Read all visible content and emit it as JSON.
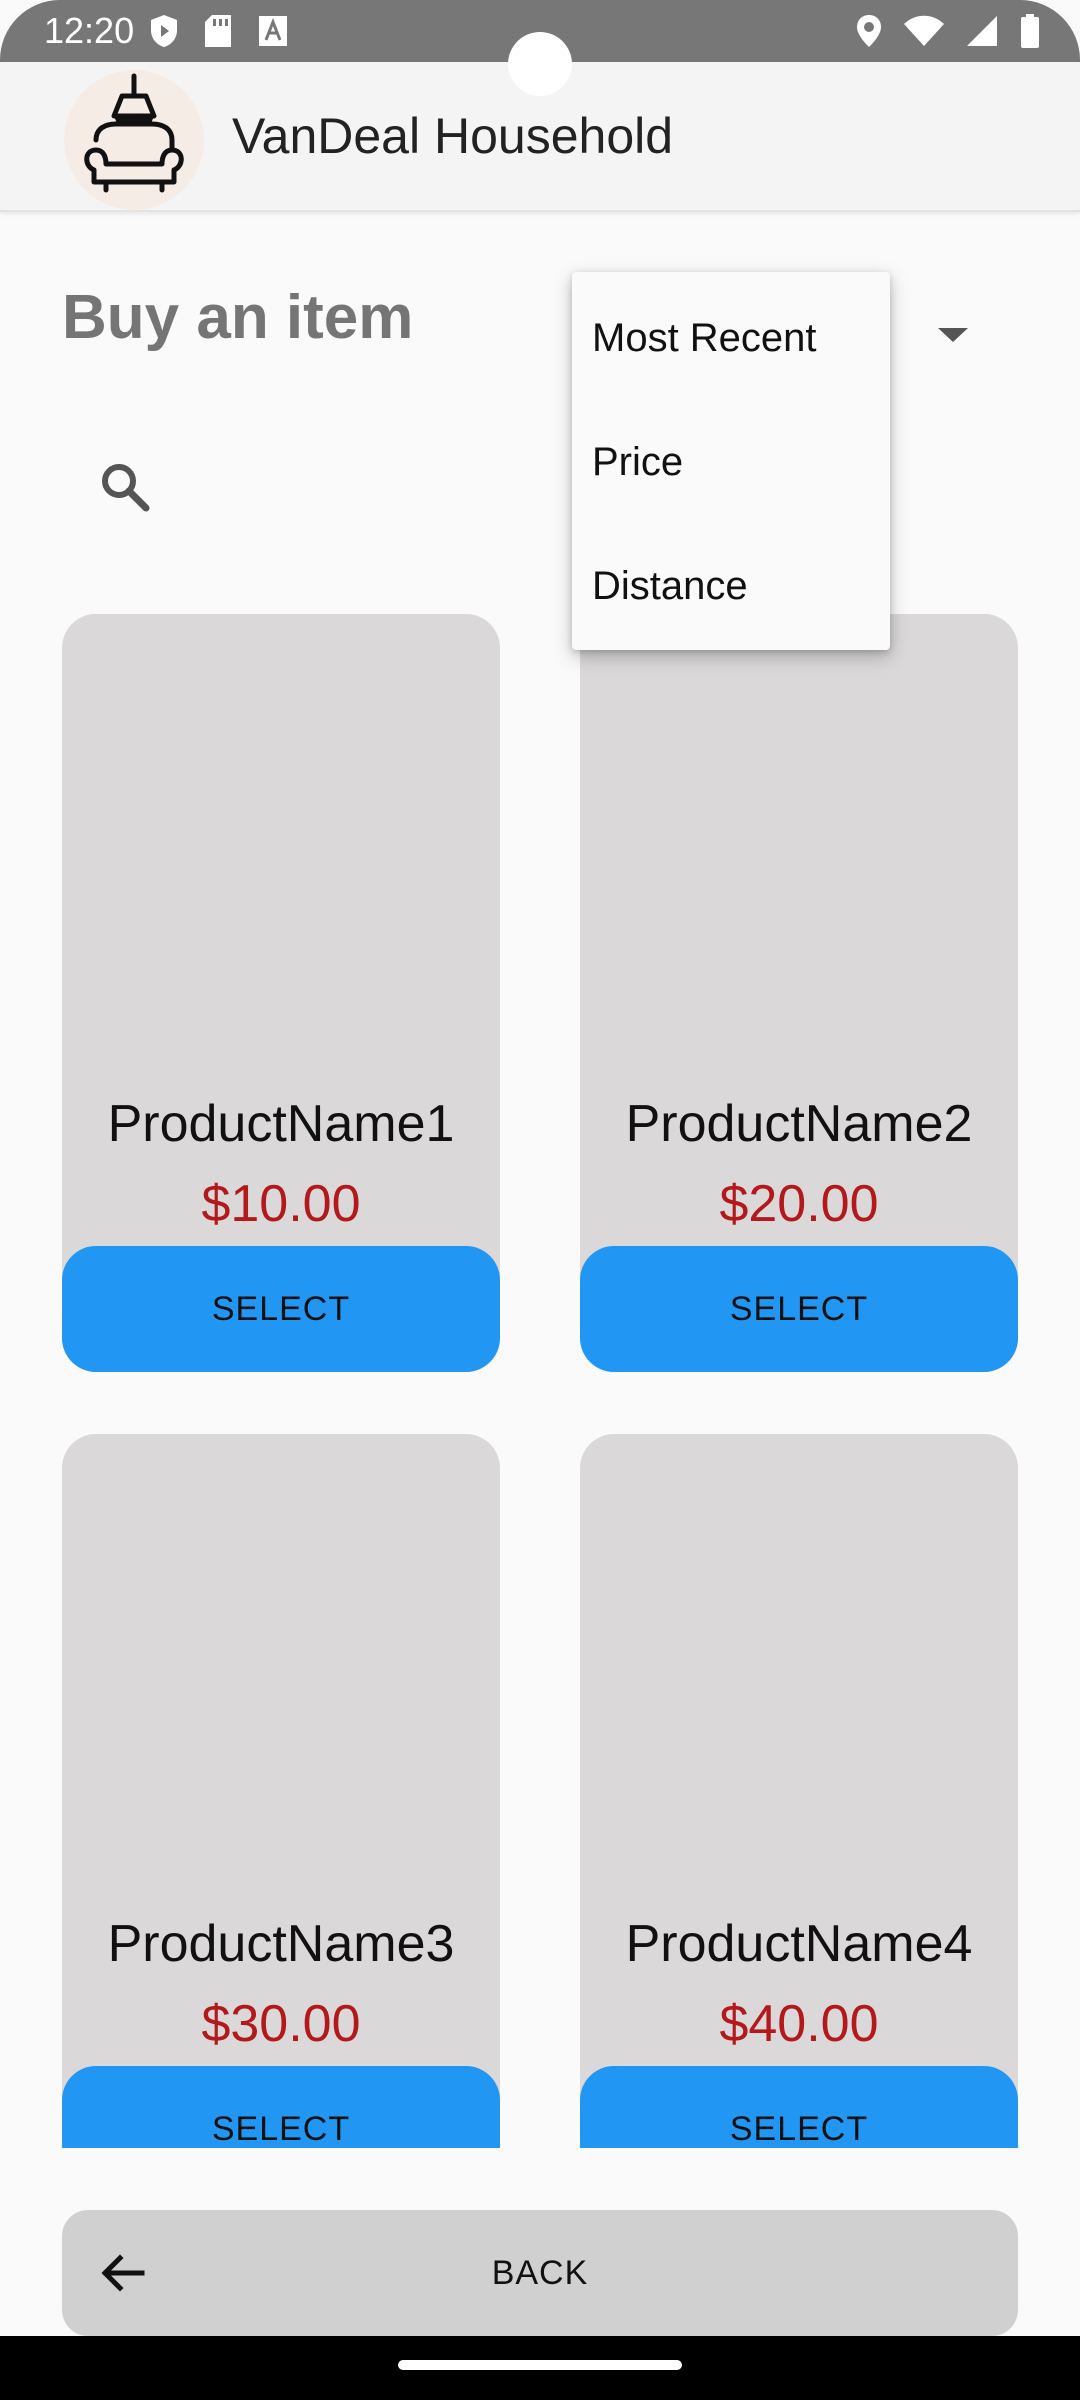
{
  "status_bar": {
    "time": "12:20"
  },
  "app_bar": {
    "title": "VanDeal Household"
  },
  "header": {
    "title": "Buy an item"
  },
  "sort_menu": {
    "items": [
      {
        "label": "Most Recent"
      },
      {
        "label": "Price"
      },
      {
        "label": "Distance"
      }
    ]
  },
  "products": [
    {
      "name": "ProductName1",
      "price": "$10.00",
      "button_label": "SELECT"
    },
    {
      "name": "ProductName2",
      "price": "$20.00",
      "button_label": "SELECT"
    },
    {
      "name": "ProductName3",
      "price": "$30.00",
      "button_label": "SELECT"
    },
    {
      "name": "ProductName4",
      "price": "$40.00",
      "button_label": "SELECT"
    }
  ],
  "footer": {
    "back_label": "BACK"
  },
  "colors": {
    "accent": "#2196f3",
    "price": "#b3191b",
    "card": "#dad8d8",
    "status_bar": "#777777"
  },
  "icons": {
    "status_left": [
      "shield-play-icon",
      "sd-card-icon",
      "font-a-icon"
    ],
    "status_right": [
      "location-icon",
      "wifi-icon",
      "signal-icon",
      "battery-icon"
    ],
    "search": "search-icon",
    "back": "arrow-left-icon",
    "dropdown": "dropdown-arrow-icon",
    "logo": "sofa-lamp-logo-icon"
  }
}
